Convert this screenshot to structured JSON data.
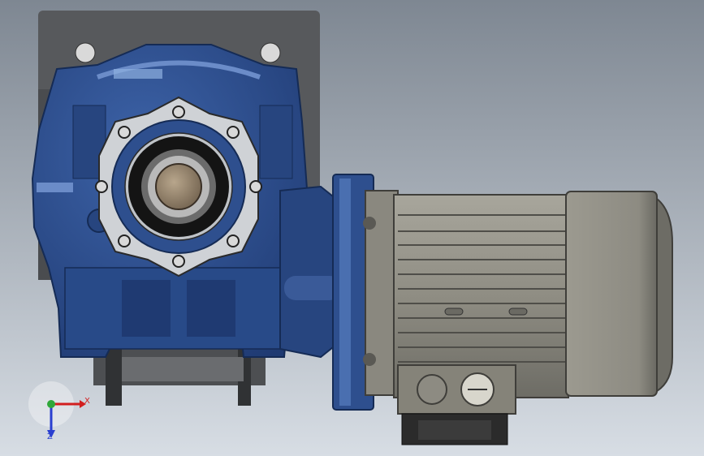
{
  "viewport": {
    "background_top": "#7e8792",
    "background_bottom": "#d7dde4"
  },
  "colors": {
    "housing_blue": "#2e4f8e",
    "housing_blue_dark": "#1c3466",
    "housing_blue_light": "#4a6fb0",
    "mount_plate": "#57595c",
    "metal_light": "#cfcfcf",
    "motor_body": "#8f8d83",
    "motor_dark": "#5f5e58",
    "motor_cap": "#97958b",
    "bearing_black": "#141414",
    "shaft_bronze": "#9c8a72"
  },
  "axes": {
    "x_label": "X",
    "z_label": "Z",
    "x_color": "#d21f1f",
    "y_color": "#2fa83a",
    "z_color": "#2a3fd0"
  }
}
